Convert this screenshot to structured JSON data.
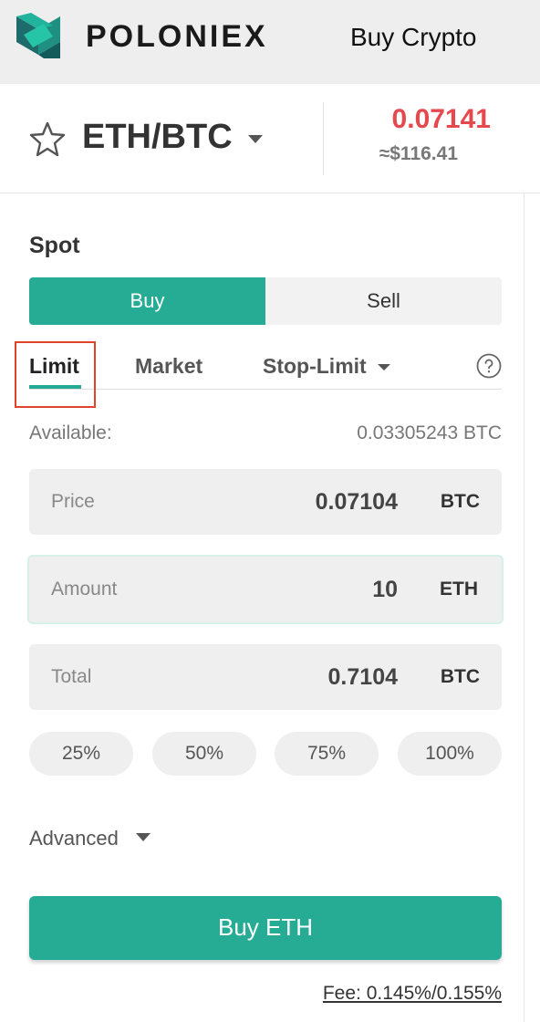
{
  "header": {
    "brand": "POLONIEX",
    "buy_crypto": "Buy Crypto",
    "logo_icon": "poloniex-logo-icon"
  },
  "pair": {
    "name": "ETH/BTC",
    "last_price": "0.07141",
    "usd_price": "≈$116.41",
    "price_color": "#e5484d",
    "favorite_icon": "star-outline-icon"
  },
  "trade": {
    "section_title": "Spot",
    "side": {
      "buy_label": "Buy",
      "sell_label": "Sell",
      "selected": "Buy"
    },
    "order_types": {
      "limit": "Limit",
      "market": "Market",
      "stop_limit": "Stop-Limit",
      "selected": "Limit"
    },
    "available_label": "Available:",
    "available_value": "0.03305243 BTC",
    "fields": {
      "price": {
        "label": "Price",
        "value": "0.07104",
        "unit": "BTC"
      },
      "amount": {
        "label": "Amount",
        "value": "10",
        "unit": "ETH"
      },
      "total": {
        "label": "Total",
        "value": "0.7104",
        "unit": "BTC"
      }
    },
    "percentages": [
      "25%",
      "50%",
      "75%",
      "100%"
    ],
    "advanced_label": "Advanced",
    "submit_label": "Buy ETH",
    "fee": "Fee: 0.145%/0.155%"
  },
  "colors": {
    "accent": "#26ac94",
    "highlight_box": "#e0442a"
  }
}
